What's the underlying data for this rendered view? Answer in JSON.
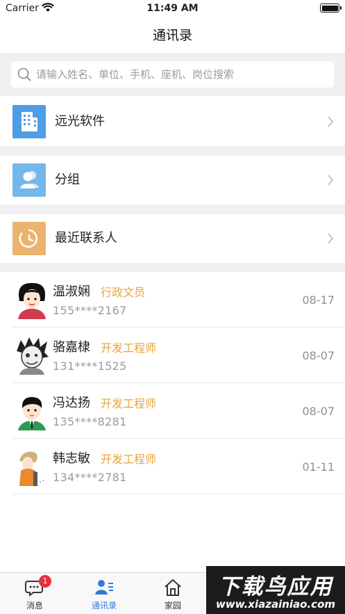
{
  "status_bar": {
    "carrier": "Carrier",
    "time": "11:49 AM"
  },
  "nav": {
    "title": "通讯录"
  },
  "search": {
    "placeholder": "请输入姓名、单位、手机、座机、岗位搜索"
  },
  "menu": [
    {
      "label": "远光软件",
      "icon": "building-icon",
      "color": "#4e9ee6"
    },
    {
      "label": "分组",
      "icon": "group-icon",
      "color": "#76b7ea"
    },
    {
      "label": "最近联系人",
      "icon": "clock-icon",
      "color": "#eab46f"
    }
  ],
  "contacts": [
    {
      "name": "温淑娴",
      "role": "行政文员",
      "phone": "155****2167",
      "date": "08-17"
    },
    {
      "name": "骆嘉棣",
      "role": "开发工程师",
      "phone": "131****1525",
      "date": "08-07"
    },
    {
      "name": "冯达扬",
      "role": "开发工程师",
      "phone": "135****8281",
      "date": "08-07"
    },
    {
      "name": "韩志敏",
      "role": "开发工程师",
      "phone": "134****2781",
      "date": "01-11"
    }
  ],
  "tabs": [
    {
      "label": "消息",
      "icon": "message-icon",
      "badge": "1"
    },
    {
      "label": "通讯录",
      "icon": "contacts-icon",
      "active": true
    },
    {
      "label": "家园",
      "icon": "home-icon"
    }
  ],
  "watermark": {
    "main": "下载鸟应用",
    "url": "www.xiazainiao.com"
  },
  "colors": {
    "accent": "#2f7bd8",
    "role": "#e9a23b",
    "badge": "#e8323a"
  }
}
